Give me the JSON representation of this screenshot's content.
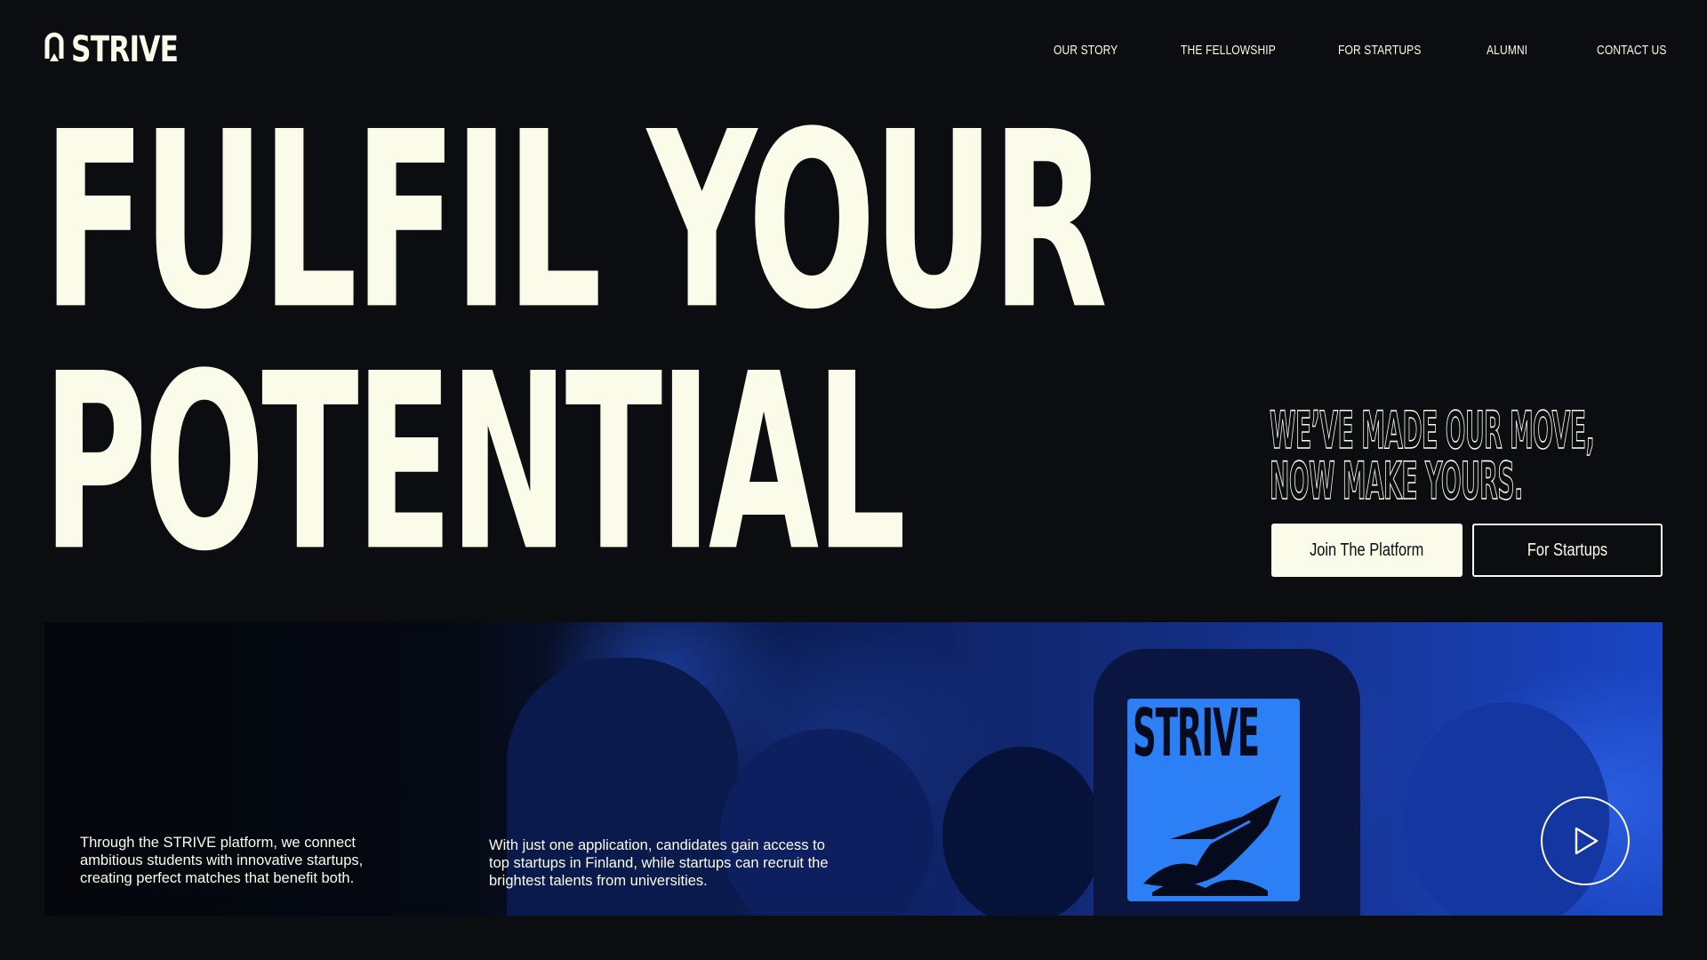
{
  "header": {
    "logo_text": "STRIVE",
    "nav": [
      {
        "label": "OUR STORY"
      },
      {
        "label": "THE FELLOWSHIP"
      },
      {
        "label": "FOR STARTUPS"
      },
      {
        "label": "ALUMNI"
      },
      {
        "label": "CONTACT US"
      }
    ]
  },
  "hero": {
    "line_1": "FULFIL YOUR",
    "line_2": "POTENTIAL",
    "tagline_1": "WE’VE MADE OUR MOVE,",
    "tagline_2": "NOW MAKE YOURS.",
    "primary_button": "Join The Platform",
    "secondary_button": "For Startups"
  },
  "banner": {
    "shirt_text": "STRIVE",
    "text_1": "Through the STRIVE platform, we connect ambitious students with innovative startups, creating perfect matches that benefit both.",
    "text_2": "With just one application, candidates gain access to top startups in  Finland, while startups can recruit the brightest talents from universities.",
    "play_icon": "play-icon"
  },
  "colors": {
    "background": "#0b0d10",
    "foreground": "#fbfbea",
    "banner_blue": "#2c7ff5"
  }
}
